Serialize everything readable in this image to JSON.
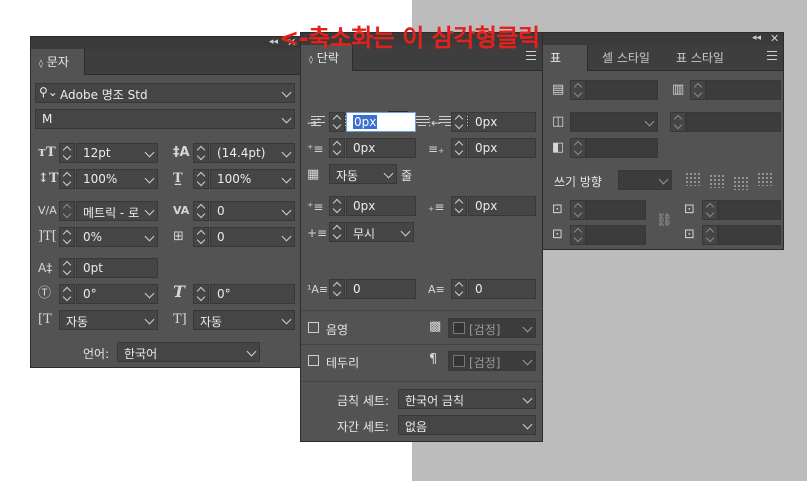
{
  "annotation": "<-축소화는 이 삼각형클릭",
  "colors": {
    "panel": "#535353",
    "annotation": "#e8201b",
    "background_right": "#bcbcbc"
  },
  "character_panel": {
    "tab": "문자",
    "font_family": "Adobe 명조 Std",
    "font_style": "M",
    "font_size": "12pt",
    "leading": "(14.4pt)",
    "vertical_scale": "100%",
    "horizontal_scale": "100%",
    "kerning": "메트릭 - 로",
    "tracking": "0",
    "tsume": "0%",
    "aki": "0",
    "baseline_shift": "0pt",
    "rotation": "0°",
    "skew": "0°",
    "aki_before": "자동",
    "aki_after": "자동",
    "language_label": "언어:",
    "language": "한국어"
  },
  "paragraph_panel": {
    "tab": "단락",
    "left_indent": "0px",
    "right_indent": "0px",
    "first_line_indent": "0px",
    "last_line_indent": "0px",
    "grid_label": "자동",
    "grid_unit": "줄",
    "space_before": "0px",
    "space_after": "0px",
    "drop_cap_label": "무시",
    "drop_cap_lines": "0",
    "drop_cap_chars": "0",
    "shading_label": "음영",
    "shading_color": "[검정]",
    "border_label": "테두리",
    "border_color": "[검정]",
    "kinsoku_label": "금칙 세트:",
    "kinsoku_value": "한국어 금칙",
    "mojikumi_label": "자간 세트:",
    "mojikumi_value": "없음"
  },
  "table_panel": {
    "tabs": [
      "표",
      "셀 스타일",
      "표 스타일"
    ],
    "writing_direction_label": "쓰기 방향"
  },
  "icons": [
    "search-icon",
    "chevron-down-icon",
    "menu-icon",
    "collapse-icon",
    "close-icon",
    "link-icon"
  ]
}
